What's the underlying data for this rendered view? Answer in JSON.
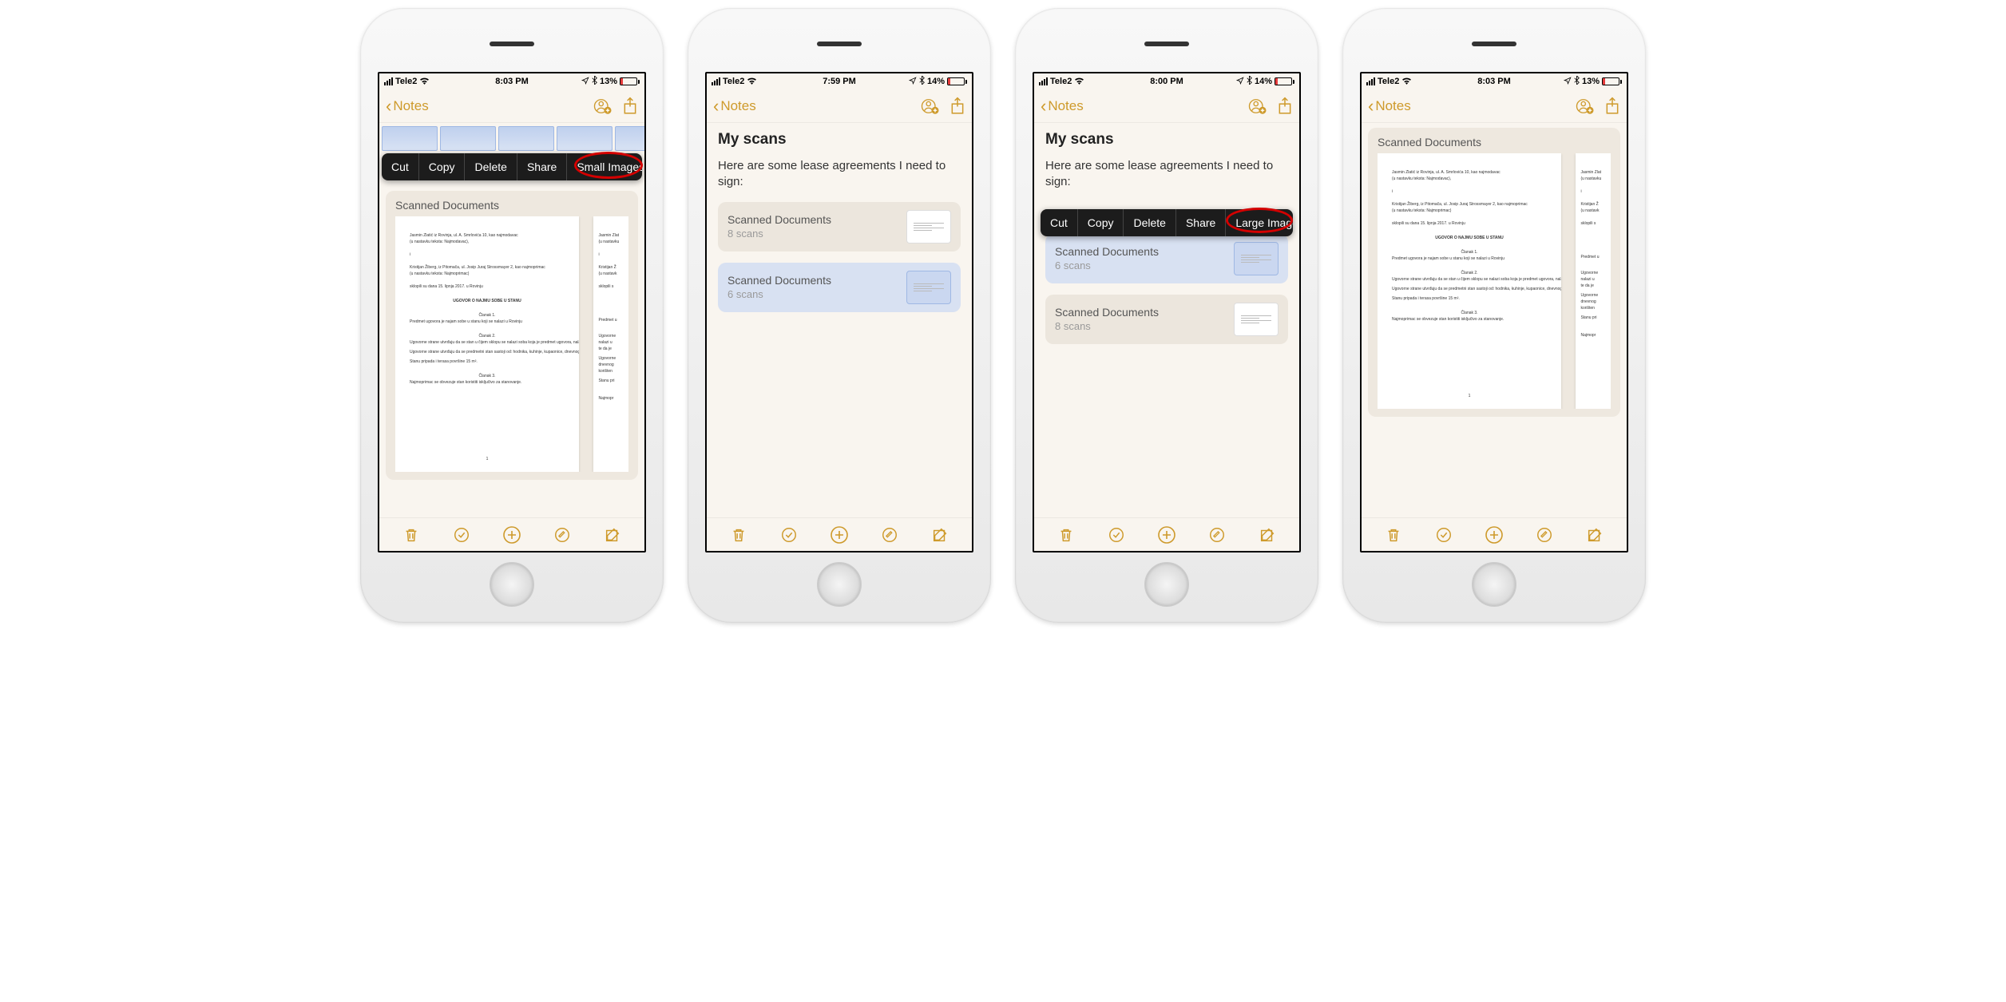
{
  "carrier": "Tele2",
  "back_label": "Notes",
  "phones": {
    "p1": {
      "time": "8:03 PM",
      "battery_pct": "13%",
      "battery_fill": 13
    },
    "p2": {
      "time": "7:59 PM",
      "battery_pct": "14%",
      "battery_fill": 14
    },
    "p3": {
      "time": "8:00 PM",
      "battery_pct": "14%",
      "battery_fill": 14
    },
    "p4": {
      "time": "8:03 PM",
      "battery_pct": "13%",
      "battery_fill": 13
    }
  },
  "context_menu": {
    "cut": "Cut",
    "copy": "Copy",
    "delete": "Delete",
    "share": "Share",
    "small_images": "Small Images",
    "large_images": "Large Images"
  },
  "doc_header": "Scanned Documents",
  "note": {
    "title": "My scans",
    "body": "Here are some lease agreements I need to sign:"
  },
  "scan_rows": {
    "r8": {
      "title": "Scanned Documents",
      "sub": "8 scans"
    },
    "r6": {
      "title": "Scanned Documents",
      "sub": "6 scans"
    }
  },
  "page_text": {
    "l1": "Jasmin Zlatić iz Rovinja, ul. A. Smrlovića 10, kao najmodavac",
    "l2": "(u nastavku teksta: Najmodavac),",
    "l3": "i",
    "l4": "Kristijan Žiberg, iz Pitomača, ul. Josip Juraj Strossmayer 2, kao najmoprimac",
    "l5": "(u nastavku teksta: Najmoprimac)",
    "l6": "sklopili su dana 15. lipnja 2017. u Rovinju",
    "t1": "UGOVOR O NAJMU SOBE U STANU",
    "c1": "Članak 1.",
    "p1": "Predmet ugovora je najam sobe u stanu koji se nalazi u Rovinju",
    "c2": "Članak 2.",
    "p2": "Ugovorne strane utvrđuju da se stan u čijem sklopu se nalazi soba koja je predmet ugovora, nalazi u obiteljskoj kući, na drugom katu, na adresi A. Smrlovića 10, Rovinj, površine 60 m², te da je vlasništvo Najmodavca.",
    "p3": "Ugovorne strane utvrđuju da se predmetni stan sastoji od: hodnika, kuhinje, kupaonice, dnevnog boravka koji spada u zajedničke prostorije, te sobe od kojih se jedna daje na korištenje najmoprimcu.",
    "p4": "Stanu pripada i terasa površine 15 m².",
    "c3": "Članak 3.",
    "p5": "Najmoprimac se obvezuje stan koristiti isključivo za stanovanje.",
    "pg": "1"
  },
  "partial": {
    "l1": "Jasmin Zlat",
    "l2": "(u nastavku",
    "l3": "i",
    "l4": "Kristijan Ž",
    "l5": "(u nastavk",
    "l6": "sklopili s",
    "p1": "Predmet u",
    "p2": "Ugovorne",
    "p2b": "nalazi u",
    "p2c": "te da je",
    "p3": "Ugovorne",
    "p3b": "dnevnog",
    "p3c": "korišten",
    "p4": "Stanu pri",
    "p5": "Najmopr"
  }
}
